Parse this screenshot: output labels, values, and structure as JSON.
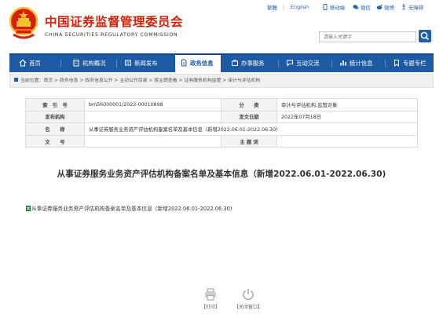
{
  "header": {
    "title": "中国证券监督管理委员会",
    "subtitle": "CHINA SECURITIES REGULATORY COMMISSION",
    "search_placeholder": "请输入关键字"
  },
  "top_links": {
    "traditional": "繁體",
    "sep": "|",
    "english": "English",
    "mobile": "移动端",
    "wechat": "微信",
    "weibo": "微博",
    "accessibility": "无障碍"
  },
  "nav": {
    "items": [
      {
        "label": "首页",
        "icon": "home-icon"
      },
      {
        "label": "机构概况",
        "icon": "building-icon"
      },
      {
        "label": "新闻发布",
        "icon": "news-icon"
      },
      {
        "label": "政务信息",
        "icon": "document-icon"
      },
      {
        "label": "办事服务",
        "icon": "service-icon"
      },
      {
        "label": "互动交流",
        "icon": "chat-icon"
      },
      {
        "label": "统计信息",
        "icon": "chart-icon"
      },
      {
        "label": "专题专栏",
        "icon": "bookmark-icon"
      }
    ],
    "active_index": 3
  },
  "breadcrumb": {
    "prefix": "当前位置：",
    "items": [
      "首页",
      "政务信息",
      "政府信息公开",
      "主动公开目录",
      "按主题查看",
      "证券服务机构监管",
      "审计与评估机构"
    ],
    "separator": " > "
  },
  "info": {
    "index_label": "索　引　号",
    "index_value": "bm56000001/2022-00010898",
    "category_label": "分　　类",
    "category_value": "审计与评估机构;监管对象",
    "publisher_label": "发布机构",
    "publisher_value": "",
    "date_label": "发文日期",
    "date_value": "2022年07月18日",
    "name_label": "名　　称",
    "name_value": "从事证券服务业务资产评估机构备案名单及基本信息（新增2022.06.01-2022.06.30）",
    "docno_label": "文　　号",
    "docno_value": "",
    "keywords_label": "主 题 词",
    "keywords_value": ""
  },
  "document": {
    "title": "从事证券服务业务资产评估机构备案名单及基本信息（新增2022.06.01-2022.06.30)",
    "attachment": "从事证券服务业务资产评估机构备案名单及基本信息（新增2022.06.01-2022.06.30)"
  },
  "actions": {
    "print": "【打印】",
    "close": "【关闭窗口】"
  },
  "colors": {
    "brand_red": "#d81e06",
    "nav_blue": "#1e5aa3",
    "link_blue": "#2b63a9"
  }
}
